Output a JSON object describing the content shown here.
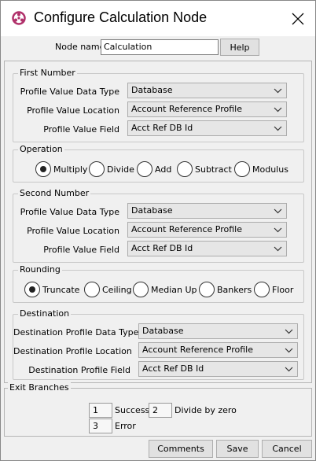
{
  "window": {
    "title": "Configure Calculation Node",
    "close_icon": "close-icon"
  },
  "node_name": {
    "label": "Node name",
    "value": "Calculation",
    "help_label": "Help"
  },
  "first_number": {
    "legend": "First Number",
    "rows": [
      {
        "label": "Profile Value Data Type",
        "value": "Database"
      },
      {
        "label": "Profile Value Location",
        "value": "Account Reference Profile"
      },
      {
        "label": "Profile Value Field",
        "value": "Acct Ref DB Id"
      }
    ]
  },
  "operation": {
    "legend": "Operation",
    "options": [
      {
        "label": "Multiply",
        "selected": true
      },
      {
        "label": "Divide",
        "selected": false
      },
      {
        "label": "Add",
        "selected": false
      },
      {
        "label": "Subtract",
        "selected": false
      },
      {
        "label": "Modulus",
        "selected": false
      }
    ]
  },
  "second_number": {
    "legend": "Second Number",
    "rows": [
      {
        "label": "Profile Value Data Type",
        "value": "Database"
      },
      {
        "label": "Profile Value Location",
        "value": "Account Reference Profile"
      },
      {
        "label": "Profile Value Field",
        "value": "Acct Ref DB Id"
      }
    ]
  },
  "rounding": {
    "legend": "Rounding",
    "options": [
      {
        "label": "Truncate",
        "selected": true
      },
      {
        "label": "Ceiling",
        "selected": false
      },
      {
        "label": "Median Up",
        "selected": false
      },
      {
        "label": "Bankers",
        "selected": false
      },
      {
        "label": "Floor",
        "selected": false
      }
    ]
  },
  "destination": {
    "legend": "Destination",
    "rows": [
      {
        "label": "Destination Profile Data Type",
        "value": "Database"
      },
      {
        "label": "Destination Profile Location",
        "value": "Account Reference Profile"
      },
      {
        "label": "Destination Profile Field",
        "value": "Acct Ref DB Id"
      }
    ]
  },
  "exit_branches": {
    "legend": "Exit Branches",
    "branches": [
      {
        "number": "1",
        "label": "Success"
      },
      {
        "number": "2",
        "label": "Divide by zero"
      },
      {
        "number": "3",
        "label": "Error"
      }
    ]
  },
  "buttons": {
    "comments": "Comments",
    "save": "Save",
    "cancel": "Cancel"
  },
  "colors": {
    "app_icon": "#b0306a"
  }
}
